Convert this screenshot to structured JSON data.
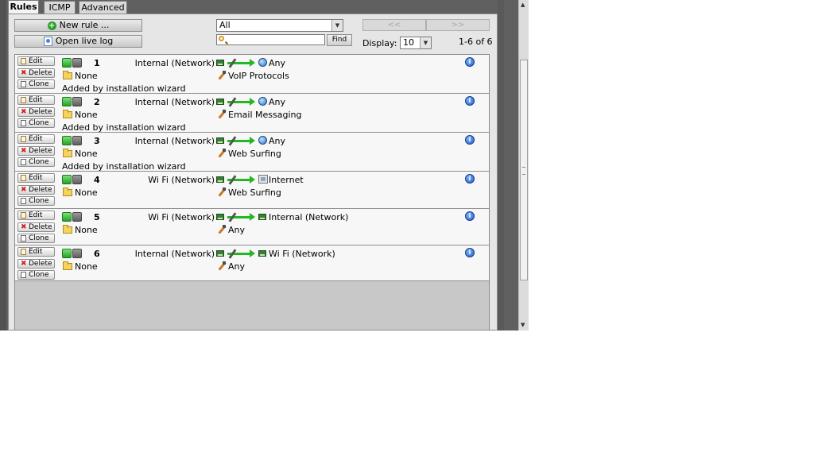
{
  "tabs": [
    {
      "label": "Rules",
      "active": true
    },
    {
      "label": "ICMP",
      "active": false
    },
    {
      "label": "Advanced",
      "active": false
    }
  ],
  "toolbar": {
    "new_rule_label": "New rule ...",
    "open_log_label": "Open live log",
    "filter_value": "All",
    "search_value": "",
    "find_label": "Find",
    "prev_label": "<<",
    "next_label": ">>",
    "display_label": "Display:",
    "display_value": "10",
    "count_text": "1-6 of 6"
  },
  "row_buttons": {
    "edit": "Edit",
    "delete": "Delete",
    "clone": "Clone"
  },
  "rules": [
    {
      "number": "1",
      "source": "Internal (Network)",
      "destination": "Any",
      "dest_icon": "globe-icon",
      "schedule": "None",
      "service": "VoIP Protocols",
      "comment": "Added by installation wizard"
    },
    {
      "number": "2",
      "source": "Internal (Network)",
      "destination": "Any",
      "dest_icon": "globe-icon",
      "schedule": "None",
      "service": "Email Messaging",
      "comment": "Added by installation wizard"
    },
    {
      "number": "3",
      "source": "Internal (Network)",
      "destination": "Any",
      "dest_icon": "globe-icon",
      "schedule": "None",
      "service": "Web Surfing",
      "comment": "Added by installation wizard"
    },
    {
      "number": "4",
      "source": "Wi Fi (Network)",
      "destination": "Internet",
      "dest_icon": "internet-icon",
      "schedule": "None",
      "service": "Web Surfing",
      "comment": ""
    },
    {
      "number": "5",
      "source": "Wi Fi (Network)",
      "destination": "Internal (Network)",
      "dest_icon": "network-card-icon",
      "schedule": "None",
      "service": "Any",
      "comment": ""
    },
    {
      "number": "6",
      "source": "Internal (Network)",
      "destination": "Wi Fi (Network)",
      "dest_icon": "network-card-icon",
      "schedule": "None",
      "service": "Any",
      "comment": ""
    }
  ],
  "colors": {
    "enabled": "#23a323",
    "accent_blue": "#1f5fc9",
    "panel_bg": "#e6e6e6",
    "frame_bg": "#606060"
  }
}
